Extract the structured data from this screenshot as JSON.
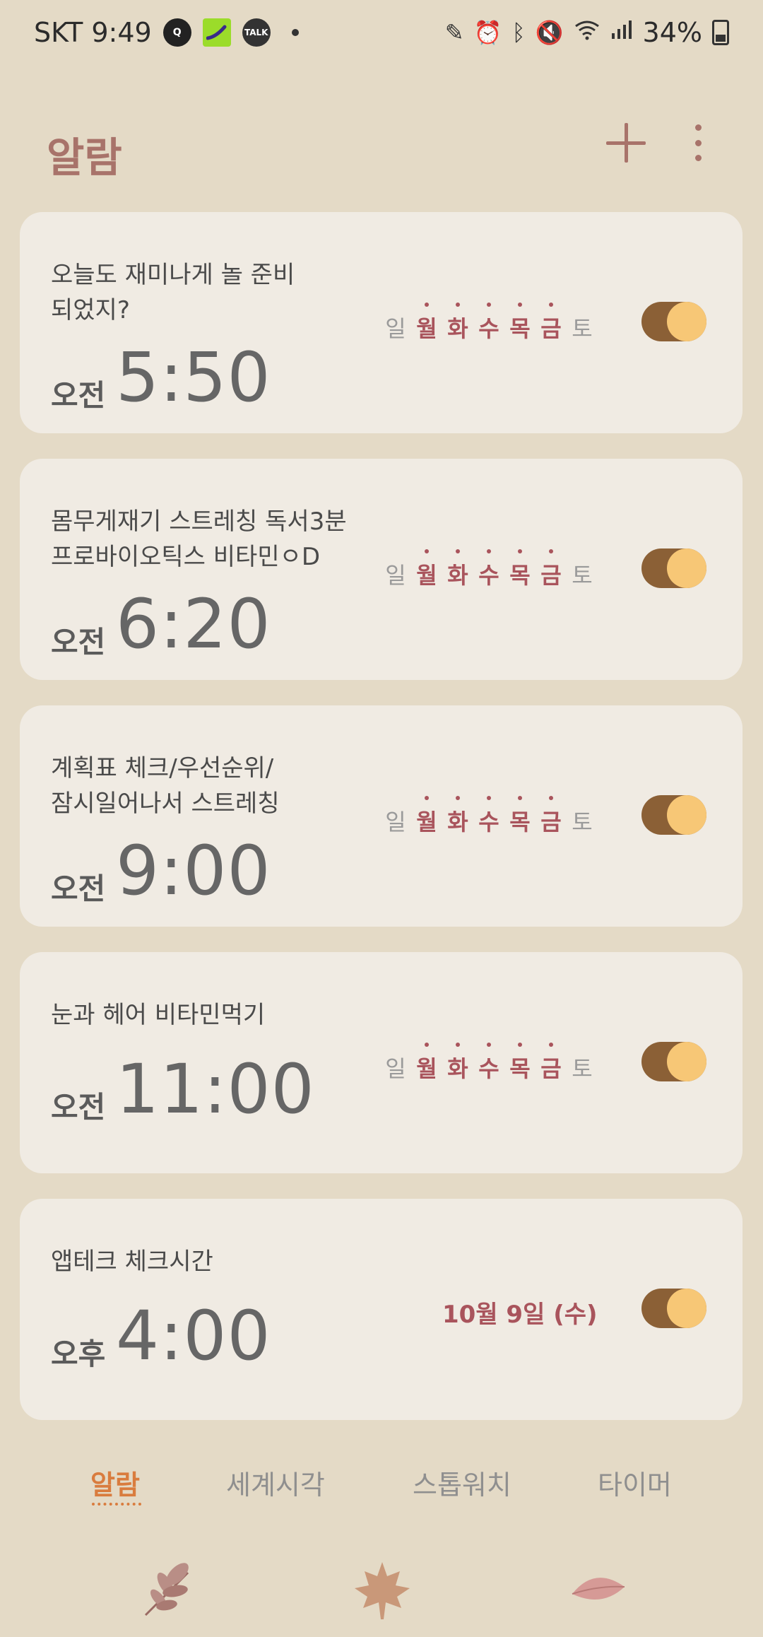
{
  "status_bar": {
    "carrier_time": "SKT 9:49",
    "battery": "34%",
    "icons": [
      "q-icon",
      "galaxy-icon",
      "talk-icon",
      "dot",
      "pencil-icon",
      "alarm-icon",
      "bluetooth-icon",
      "mute-icon",
      "wifi-icon",
      "signal-icon",
      "battery-icon"
    ],
    "talk_badge": "TALK"
  },
  "header": {
    "title": "알람"
  },
  "alarms": [
    {
      "label_line1": "오늘도 재미나게 놀 준비",
      "label_line2": "되었지?",
      "ampm": "오전",
      "time": "5:50",
      "days": [
        "일",
        "월",
        "화",
        "수",
        "목",
        "금",
        "토"
      ],
      "active_days": [
        "월",
        "화",
        "수",
        "목",
        "금"
      ],
      "enabled": true
    },
    {
      "label_line1": "몸무게재기 스트레칭 독서3분",
      "label_line2": "프로바이오틱스 비타민ㅇD",
      "ampm": "오전",
      "time": "6:20",
      "days": [
        "일",
        "월",
        "화",
        "수",
        "목",
        "금",
        "토"
      ],
      "active_days": [
        "월",
        "화",
        "수",
        "목",
        "금"
      ],
      "enabled": true
    },
    {
      "label_line1": "계획표 체크/우선순위/",
      "label_line2": "잠시일어나서 스트레칭",
      "ampm": "오전",
      "time": "9:00",
      "days": [
        "일",
        "월",
        "화",
        "수",
        "목",
        "금",
        "토"
      ],
      "active_days": [
        "월",
        "화",
        "수",
        "목",
        "금"
      ],
      "enabled": true
    },
    {
      "label_line1": "눈과 헤어 비타민먹기",
      "ampm": "오전",
      "time": "11:00",
      "days": [
        "일",
        "월",
        "화",
        "수",
        "목",
        "금",
        "토"
      ],
      "active_days": [
        "월",
        "화",
        "수",
        "목",
        "금"
      ],
      "enabled": true
    },
    {
      "label_line1": "앱테크 체크시간",
      "ampm": "오후",
      "time": "4:00",
      "date": "10월 9일 (수)",
      "enabled": true
    }
  ],
  "tabs": [
    {
      "label": "알람",
      "active": true
    },
    {
      "label": "세계시각",
      "active": false
    },
    {
      "label": "스톱워치",
      "active": false
    },
    {
      "label": "타이머",
      "active": false
    }
  ],
  "colors": {
    "background": "#e4dac6",
    "card": "#f0ebe3",
    "accent": "#a8736a",
    "active_day": "#a9545c",
    "toggle_track": "#8b6036",
    "toggle_knob": "#f7c776",
    "active_tab": "#d97c3e"
  }
}
